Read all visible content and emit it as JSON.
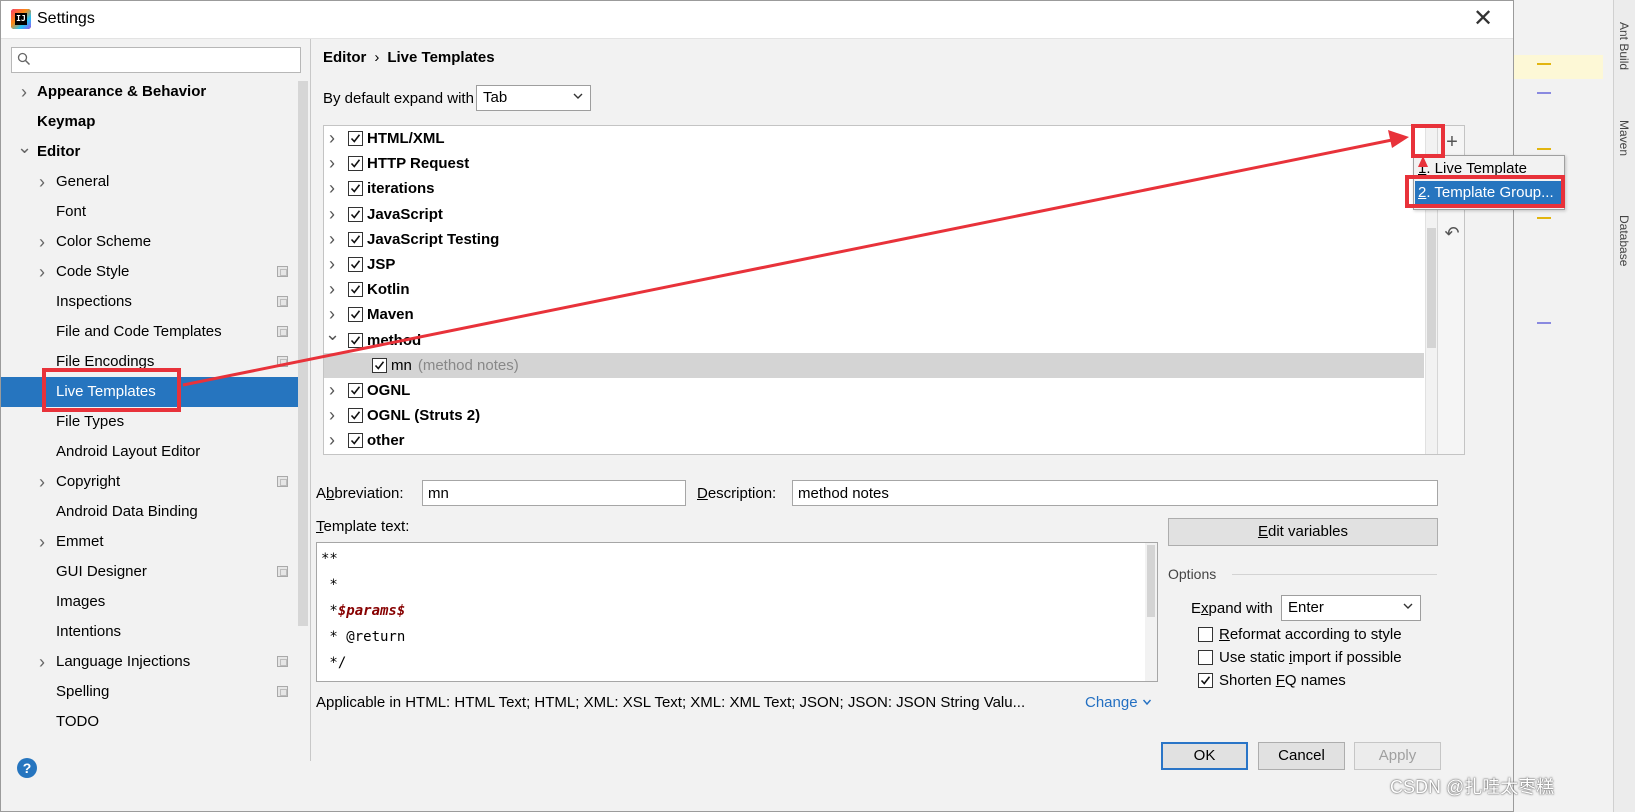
{
  "window": {
    "title": "Settings"
  },
  "sidebar": {
    "search_placeholder": "",
    "items": [
      {
        "label": "Appearance & Behavior",
        "bold": true,
        "chevron": "right"
      },
      {
        "label": "Keymap",
        "bold": true
      },
      {
        "label": "Editor",
        "bold": true,
        "chevron": "down"
      },
      {
        "label": "General",
        "chevron": "right"
      },
      {
        "label": "Font"
      },
      {
        "label": "Color Scheme",
        "chevron": "right"
      },
      {
        "label": "Code Style",
        "chevron": "right",
        "config_icon": true
      },
      {
        "label": "Inspections",
        "config_icon": true
      },
      {
        "label": "File and Code Templates",
        "config_icon": true
      },
      {
        "label": "File Encodings",
        "config_icon": true
      },
      {
        "label": "Live Templates",
        "selected": true
      },
      {
        "label": "File Types"
      },
      {
        "label": "Android Layout Editor"
      },
      {
        "label": "Copyright",
        "chevron": "right",
        "config_icon": true
      },
      {
        "label": "Android Data Binding"
      },
      {
        "label": "Emmet",
        "chevron": "right"
      },
      {
        "label": "GUI Designer",
        "config_icon": true
      },
      {
        "label": "Images"
      },
      {
        "label": "Intentions"
      },
      {
        "label": "Language Injections",
        "chevron": "right",
        "config_icon": true
      },
      {
        "label": "Spelling",
        "config_icon": true
      },
      {
        "label": "TODO"
      }
    ]
  },
  "breadcrumb": {
    "parent": "Editor",
    "sep": "›",
    "current": "Live Templates"
  },
  "expand": {
    "label": "By default expand with",
    "value": "Tab"
  },
  "templates": [
    {
      "label": "HTML/XML",
      "checked": true,
      "chevron": "right"
    },
    {
      "label": "HTTP Request",
      "checked": true,
      "chevron": "right"
    },
    {
      "label": "iterations",
      "checked": true,
      "chevron": "right"
    },
    {
      "label": "JavaScript",
      "checked": true,
      "chevron": "right"
    },
    {
      "label": "JavaScript Testing",
      "checked": true,
      "chevron": "right"
    },
    {
      "label": "JSP",
      "checked": true,
      "chevron": "right"
    },
    {
      "label": "Kotlin",
      "checked": true,
      "chevron": "right"
    },
    {
      "label": "Maven",
      "checked": true,
      "chevron": "right"
    },
    {
      "label": "method",
      "checked": true,
      "chevron": "down"
    },
    {
      "label": "mn",
      "desc": "(method notes)",
      "checked": true,
      "child": true,
      "selected": true
    },
    {
      "label": "OGNL",
      "checked": true,
      "chevron": "right"
    },
    {
      "label": "OGNL (Struts 2)",
      "checked": true,
      "chevron": "right"
    },
    {
      "label": "other",
      "checked": true,
      "chevron": "right"
    }
  ],
  "popup": {
    "item1_num": "1",
    "item1_label": ". Live Template",
    "item2_num": "2",
    "item2_label": ". Template Group..."
  },
  "form": {
    "abbrev_label_pre": "A",
    "abbrev_label_u": "b",
    "abbrev_label_post": "breviation:",
    "abbrev_value": "mn",
    "desc_label_u": "D",
    "desc_label_post": "escription:",
    "desc_value": "method notes",
    "template_text_label_u": "T",
    "template_text_label_post": "emplate text:",
    "edit_vars_pre": "",
    "edit_vars_u": "E",
    "edit_vars_post": "dit variables"
  },
  "template_lines": [
    "**",
    " *",
    " *",
    "$params$",
    " * @return",
    " */"
  ],
  "options": {
    "title": "Options",
    "expand_label_pre": "E",
    "expand_label_u": "x",
    "expand_label_post": "pand with",
    "expand_value": "Enter",
    "reformat_u": "R",
    "reformat_post": "eformat according to style",
    "reformat_checked": false,
    "static_pre": "Use static ",
    "static_u": "i",
    "static_post": "mport if possible",
    "static_checked": false,
    "shorten_pre": "Shorten ",
    "shorten_u": "F",
    "shorten_post": "Q names",
    "shorten_checked": true
  },
  "applicable": {
    "text": "Applicable in HTML: HTML Text; HTML; XML: XSL Text; XML: XML Text; JSON; JSON: JSON String Valu...",
    "change": "Change"
  },
  "buttons": {
    "ok": "OK",
    "cancel": "Cancel",
    "apply": "Apply"
  },
  "help": "?",
  "ide": {
    "tab1": "Ant Build",
    "tab2": "Maven",
    "tab3": "Database"
  },
  "watermark": "CSDN @扎哇太枣糕",
  "colors": {
    "accent": "#2675bf",
    "annotation": "#e8323a"
  }
}
